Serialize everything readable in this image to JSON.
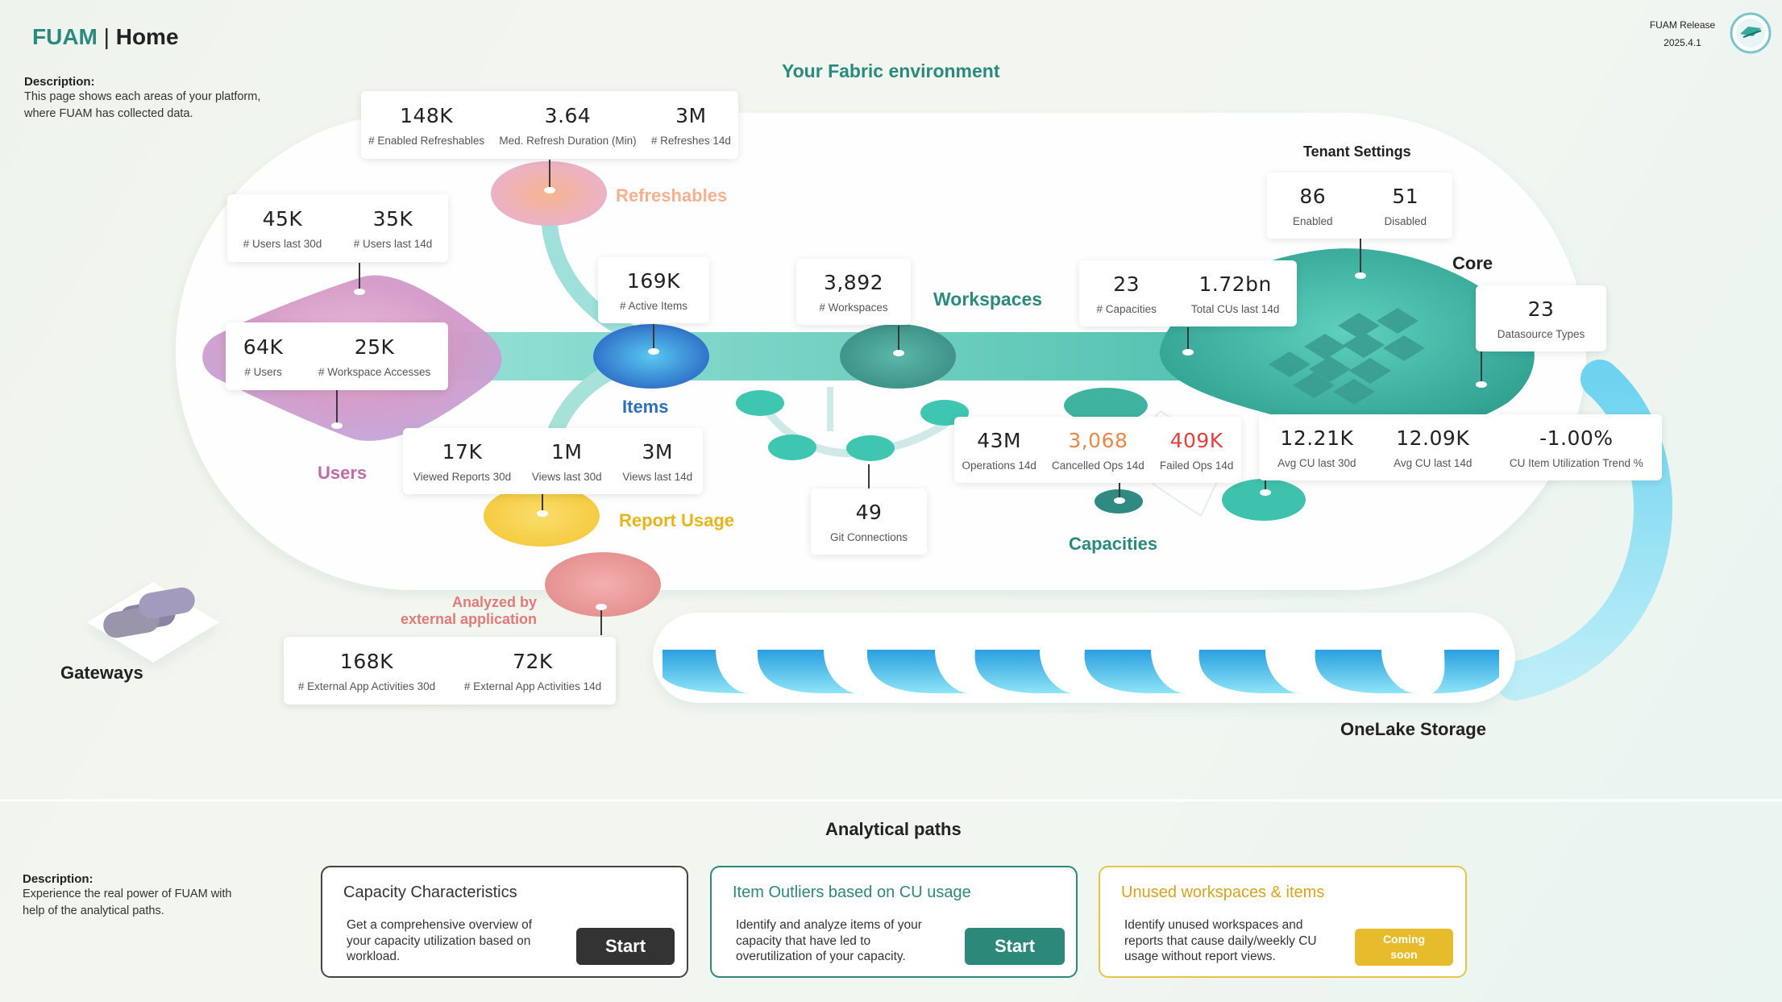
{
  "header": {
    "brand": "FUAM",
    "separator": "|",
    "page": "Home"
  },
  "release": {
    "label": "FUAM Release",
    "version": "2025.4.1"
  },
  "top_description": {
    "heading": "Description:",
    "text": "This page shows each areas of your platform, where FUAM has collected data."
  },
  "environment_title": "Your Fabric environment",
  "labels": {
    "refreshables": "Refreshables",
    "users": "Users",
    "items": "Items",
    "workspaces": "Workspaces",
    "report_usage": "Report Usage",
    "capacities": "Capacities",
    "core": "Core",
    "tenant_settings": "Tenant Settings",
    "gateways": "Gateways",
    "analyzed_line1": "Analyzed by",
    "analyzed_line2": "external application",
    "onelake": "OneLake Storage"
  },
  "metrics": {
    "refreshables": [
      {
        "value": "148K",
        "label": "# Enabled Refreshables"
      },
      {
        "value": "3.64",
        "label": "Med. Refresh Duration (Min)"
      },
      {
        "value": "3M",
        "label": "# Refreshes 14d"
      }
    ],
    "users_recent": [
      {
        "value": "45K",
        "label": "# Users last 30d"
      },
      {
        "value": "35K",
        "label": "# Users last 14d"
      }
    ],
    "users_total": [
      {
        "value": "64K",
        "label": "# Users"
      },
      {
        "value": "25K",
        "label": "# Workspace Accesses"
      }
    ],
    "items": [
      {
        "value": "169K",
        "label": "# Active Items"
      }
    ],
    "workspaces": [
      {
        "value": "3,892",
        "label": "# Workspaces"
      }
    ],
    "capacities_top": [
      {
        "value": "23",
        "label": "# Capacities"
      },
      {
        "value": "1.72bn",
        "label": "Total CUs last 14d"
      }
    ],
    "tenant_settings": [
      {
        "value": "86",
        "label": "Enabled"
      },
      {
        "value": "51",
        "label": "Disabled"
      }
    ],
    "datasource": [
      {
        "value": "23",
        "label": "Datasource Types"
      }
    ],
    "report_usage": [
      {
        "value": "17K",
        "label": "Viewed Reports 30d"
      },
      {
        "value": "1M",
        "label": "Views last 30d"
      },
      {
        "value": "3M",
        "label": "Views last 14d"
      }
    ],
    "git": [
      {
        "value": "49",
        "label": "Git Connections"
      }
    ],
    "operations": [
      {
        "value": "43M",
        "label": "Operations 14d"
      },
      {
        "value": "3,068",
        "label": "Cancelled Ops 14d"
      },
      {
        "value": "409K",
        "label": "Failed Ops 14d"
      }
    ],
    "cu": [
      {
        "value": "12.21K",
        "label": "Avg CU last 30d"
      },
      {
        "value": "12.09K",
        "label": "Avg CU last 14d"
      },
      {
        "value": "-1.00%",
        "label": "CU Item Utilization Trend %"
      }
    ],
    "external": [
      {
        "value": "168K",
        "label": "# External App Activities 30d"
      },
      {
        "value": "72K",
        "label": "# External App Activities 14d"
      }
    ]
  },
  "analytical": {
    "title": "Analytical paths",
    "description": {
      "heading": "Description:",
      "text": "Experience the real power of FUAM with help of the analytical paths."
    },
    "cards": [
      {
        "title": "Capacity Characteristics",
        "text": "Get a comprehensive overview of your capacity utilization based on workload.",
        "button": "Start"
      },
      {
        "title": "Item Outliers based on CU usage",
        "text": "Identify and analyze items of your capacity that have led to overutilization of your capacity.",
        "button": "Start"
      },
      {
        "title": "Unused workspaces & items",
        "text": "Identify unused workspaces and reports that cause daily/weekly CU usage without report views.",
        "button": "Coming soon"
      }
    ]
  },
  "colors": {
    "teal": "#2a8a7e",
    "users_purple": "#c06aa8",
    "refresh_peach": "#f5b08f",
    "report_gold": "#e8b41a",
    "items_blue": "#2e78c8",
    "analyzed_red": "#e07a78",
    "cancelled_orange": "#e8874a",
    "failed_red": "#e0403f",
    "onelake_cyan": "#3fc0e8",
    "start_dark": "#333333",
    "start_teal": "#2c8878",
    "soon_gold": "#e6bb2c"
  },
  "icons": [
    "fuam-logo-icon",
    "gateway-icon",
    "onelake-waves-icon",
    "git-nodes-icon"
  ]
}
